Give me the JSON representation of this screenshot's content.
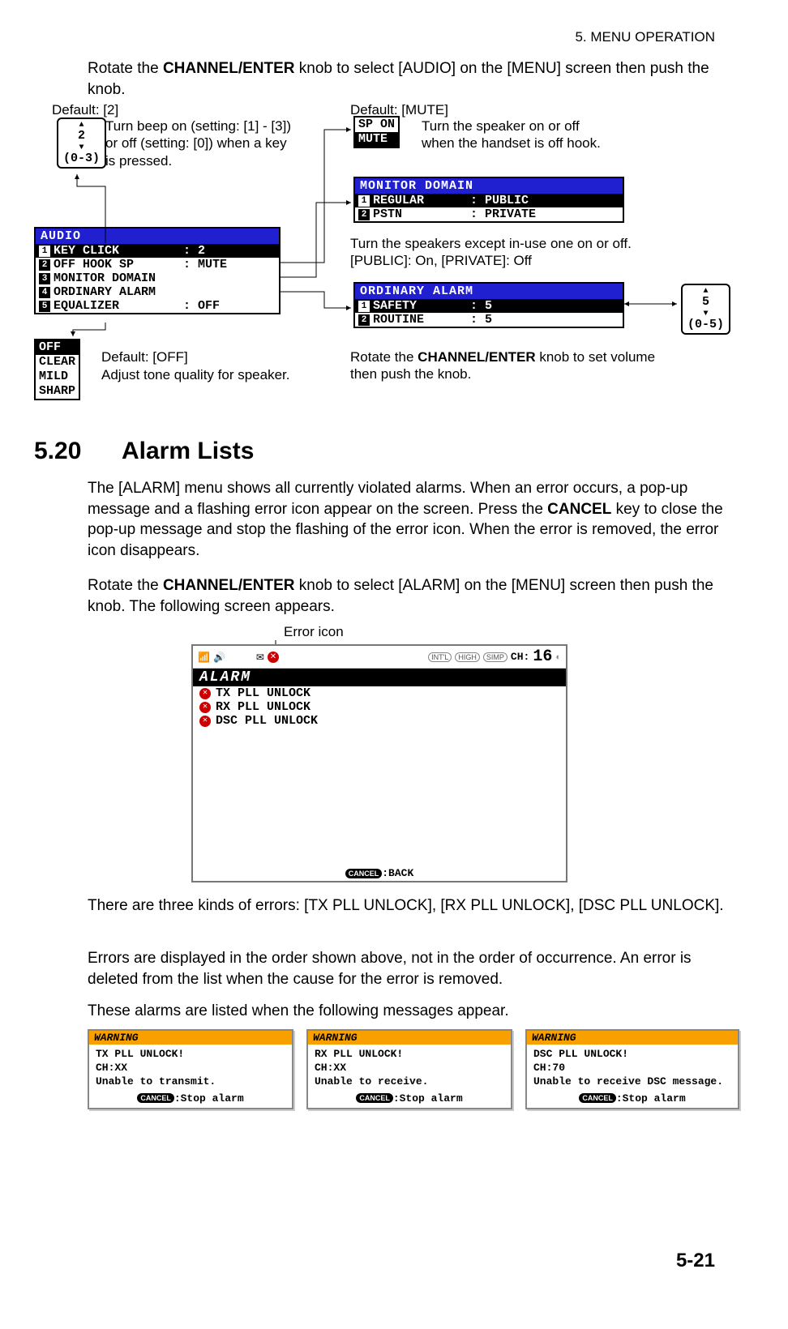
{
  "header": {
    "chapter": "5.  MENU OPERATION"
  },
  "footer": {
    "page": "5-21"
  },
  "intro": {
    "line1_pre": "Rotate the ",
    "line1_bold": "CHANNEL/ENTER",
    "line1_post": " knob to select [AUDIO] on the [MENU] screen then push the knob."
  },
  "defaults": {
    "key_click": "Default: [2]",
    "off_hook": "Default: [MUTE]",
    "equalizer": "Default: [OFF]"
  },
  "captions": {
    "key_click": "Turn beep on (setting: [1] - [3]) or off (setting: [0]) when a key is pressed.",
    "off_hook": "Turn the speaker on or off when the handset is off hook.",
    "monitor": "Turn the speakers except in-use one on or off. [PUBLIC]: On, [PRIVATE]: Off",
    "ordinary_pre": "Rotate the ",
    "ordinary_bold": "CHANNEL/ENTER",
    "ordinary_post": " knob to set volume then push the knob.",
    "equalizer": "Adjust tone quality for speaker."
  },
  "range_boxes": {
    "key_click": {
      "value": "2",
      "range": "(0-3)"
    },
    "ordinary": {
      "value": "5",
      "range": "(0-5)"
    }
  },
  "sp_box": {
    "opt1": "SP ON",
    "opt2": "MUTE"
  },
  "eq_box": {
    "sel": "OFF",
    "opts": [
      "CLEAR",
      "MILD",
      "SHARP"
    ]
  },
  "audio_menu": {
    "title": "AUDIO",
    "rows": [
      {
        "n": "1",
        "label": "KEY CLICK",
        "val": ": 2",
        "selected": true
      },
      {
        "n": "2",
        "label": "OFF HOOK SP",
        "val": ": MUTE"
      },
      {
        "n": "3",
        "label": "MONITOR DOMAIN",
        "val": ""
      },
      {
        "n": "4",
        "label": "ORDINARY ALARM",
        "val": ""
      },
      {
        "n": "5",
        "label": "EQUALIZER",
        "val": ": OFF"
      }
    ]
  },
  "monitor_menu": {
    "title": "MONITOR DOMAIN",
    "rows": [
      {
        "n": "1",
        "label": "REGULAR",
        "val": ": PUBLIC",
        "selected": true
      },
      {
        "n": "2",
        "label": "PSTN",
        "val": ": PRIVATE"
      }
    ]
  },
  "ordinary_menu": {
    "title": "ORDINARY ALARM",
    "rows": [
      {
        "n": "1",
        "label": "SAFETY",
        "val": ": 5",
        "selected": true
      },
      {
        "n": "2",
        "label": "ROUTINE",
        "val": ": 5"
      }
    ]
  },
  "section": {
    "num": "5.20",
    "title": "Alarm Lists"
  },
  "alarm_text": {
    "p1_pre": "The [ALARM] menu shows all currently violated alarms. When an error occurs, a pop-up message and a flashing error icon appear on the screen. Press the ",
    "p1_bold": "CANCEL",
    "p1_post": " key to close the pop-up message and stop the flashing of the error icon. When the error is removed, the error icon disappears.",
    "p2_pre": "Rotate the ",
    "p2_bold": "CHANNEL/ENTER",
    "p2_post": " knob to select [ALARM] on the [MENU] screen then push the knob. The following screen appears.",
    "error_icon_label": "Error icon",
    "p3": "There are three kinds of errors: [TX PLL UNLOCK], [RX PLL UNLOCK], [DSC PLL UNLOCK].",
    "p4": "Errors are displayed in the order shown above, not in the order of occurrence. An error is deleted from the list when the cause for the error is removed.",
    "p5": "These alarms are listed when the following messages appear."
  },
  "alarm_screen": {
    "title": "ALARM",
    "badges": {
      "intl": "INT'L",
      "high": "HIGH",
      "simp": "SIMP"
    },
    "ch_label": "CH:",
    "ch_value": "16",
    "items": [
      "TX PLL UNLOCK",
      "RX PLL UNLOCK",
      "DSC PLL UNLOCK"
    ],
    "footer_label": ":BACK",
    "cancel": "CANCEL"
  },
  "warnings": [
    {
      "title": "WARNING",
      "l1": "TX PLL UNLOCK!",
      "l2": "CH:XX",
      "l3": "Unable to transmit.",
      "foot": ":Stop alarm"
    },
    {
      "title": "WARNING",
      "l1": "RX PLL UNLOCK!",
      "l2": "CH:XX",
      "l3": "Unable to receive.",
      "foot": ":Stop alarm"
    },
    {
      "title": "WARNING",
      "l1": "DSC PLL UNLOCK!",
      "l2": "CH:70",
      "l3": "Unable to receive DSC message.",
      "foot": ":Stop alarm"
    }
  ]
}
